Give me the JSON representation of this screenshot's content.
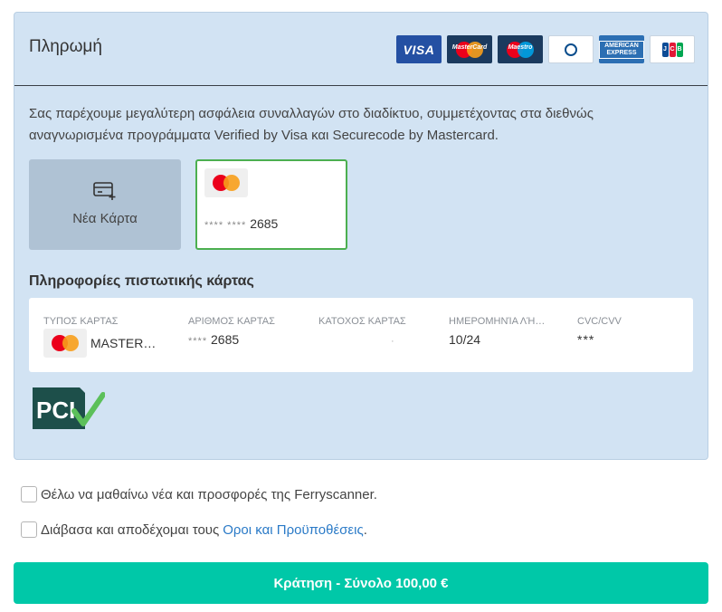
{
  "payment": {
    "title": "Πληρωμή",
    "brands": [
      {
        "name": "visa",
        "label": "VISA"
      },
      {
        "name": "mastercard",
        "label": "MasterCard"
      },
      {
        "name": "maestro",
        "label": "Maestro"
      },
      {
        "name": "diners",
        "label": "Diners Club"
      },
      {
        "name": "amex",
        "label": "AMERICAN EXPRESS"
      },
      {
        "name": "jcb",
        "label": "JCB"
      }
    ],
    "intro": "Σας παρέχουμε μεγαλύτερη ασφάλεια συναλλαγών στο διαδίκτυο, συμμετέχοντας στα διεθνώς αναγνωρισμένα προγράμματα Verified by Visa και Securecode by Mastercard.",
    "new_card_label": "Νέα Κάρτα",
    "saved_card": {
      "masked_prefix": "**** ****",
      "last4": "2685",
      "brand_icon": "mastercard-icon"
    },
    "info_title": "Πληροφορίες πιστωτικής κάρτας",
    "info": {
      "type_header": "ΤΥΠΟΣ ΚΑΡΤΑΣ",
      "type_value": "MASTER…",
      "number_header": "ΑΡΙΘΜΟΣ ΚΑΡΤΑΣ",
      "number_value_prefix": "****",
      "number_value_last4": "2685",
      "holder_header": "ΚΑΤΟΧΟΣ ΚΑΡΤΑΣ",
      "holder_value": "·",
      "expiry_header": "ΗΜΕΡΟΜΗΝΊΑ ΛΉ…",
      "expiry_value": "10/24",
      "cvc_header": "CVC/CVV",
      "cvc_value": "***"
    },
    "pci_label": "PCI"
  },
  "consents": {
    "newsletter_label": "Θέλω να μαθαίνω νέα και προσφορές της Ferryscanner.",
    "terms_prefix": "Διάβασα και αποδέχομαι τους",
    "terms_link": "Οροι και Προϋποθέσεις",
    "terms_suffix": "."
  },
  "book_button": {
    "label": "Κράτηση - Σύνολο 100,00 €"
  },
  "colors": {
    "panel_bg": "#d2e3f3",
    "selected_border": "#4caf50",
    "button_bg": "#00c8a8",
    "link": "#2a7ac7"
  }
}
